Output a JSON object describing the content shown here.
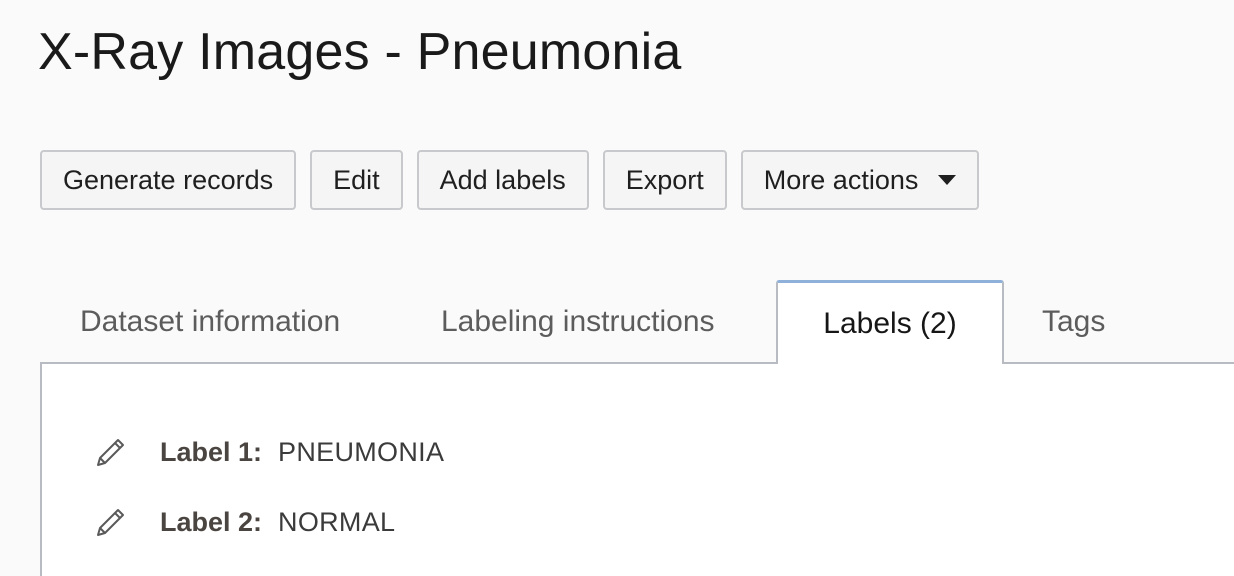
{
  "page": {
    "title": "X-Ray Images - Pneumonia"
  },
  "toolbar": {
    "generate_records": "Generate records",
    "edit": "Edit",
    "add_labels": "Add labels",
    "export": "Export",
    "more_actions": "More actions"
  },
  "tabs": {
    "dataset_information": "Dataset information",
    "labeling_instructions": "Labeling instructions",
    "labels": "Labels (2)",
    "tags": "Tags",
    "active": "Labels (2)"
  },
  "labels": [
    {
      "key": "Label 1:",
      "value": "PNEUMONIA"
    },
    {
      "key": "Label 2:",
      "value": "NORMAL"
    }
  ],
  "icons": {
    "edit": "pencil-icon",
    "more_actions_dropdown": "chevron-down-icon"
  },
  "colors": {
    "background": "#fafafa",
    "panel": "#ffffff",
    "active_tab_top_border": "#8fb1d9",
    "border": "#b8bcc2"
  }
}
